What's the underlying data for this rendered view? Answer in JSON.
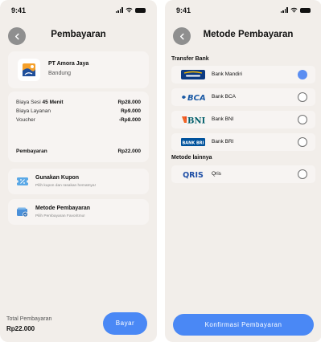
{
  "status": {
    "time": "9:41"
  },
  "payment": {
    "title": "Pembayaran",
    "merchant": {
      "name": "PT Amora Jaya",
      "city": "Bandung"
    },
    "details": [
      {
        "label_prefix": "Biaya Sesi ",
        "label_bold": "45 Menit",
        "value": "Rp28.000"
      },
      {
        "label_prefix": "Biaya Layanan",
        "label_bold": "",
        "value": "Rp9.000"
      },
      {
        "label_prefix": "Voucher",
        "label_bold": "",
        "value": "-Rp8.000"
      }
    ],
    "total": {
      "label": "Pembayaran",
      "value": "Rp22.000"
    },
    "coupon": {
      "title": "Gunakan Kupon",
      "subtitle": "Pilih kupon dan rasakan hematnya!"
    },
    "method": {
      "title": "Metode Pembayaran",
      "subtitle": "Pilih Pembayaran Favoritmu!"
    },
    "footer": {
      "label": "Total Pembayaran",
      "amount": "Rp22.000",
      "button": "Bayar"
    }
  },
  "methods": {
    "title": "Metode Pembayaran",
    "bank_section": "Transfer Bank",
    "banks": [
      {
        "name": "Bank Mandiri",
        "logo": "mandiri-logo",
        "selected": true
      },
      {
        "name": "Bank BCA",
        "logo": "bca-logo",
        "selected": false
      },
      {
        "name": "Bank BNI",
        "logo": "bni-logo",
        "selected": false
      },
      {
        "name": "Bank BRI",
        "logo": "bri-logo",
        "selected": false
      }
    ],
    "other_section": "Metode lainnya",
    "others": [
      {
        "name": "Qris",
        "logo": "qris-logo",
        "selected": false
      }
    ],
    "logo_text": {
      "bca": "BCA",
      "bni": "BNI",
      "qris": "QRIS",
      "bri": "BANK BRI"
    },
    "confirm_button": "Konfirmasi Pembayaran"
  },
  "colors": {
    "accent": "#4a88f5",
    "screen_bg": "#f2eeea",
    "card_bg": "#f7f4f2",
    "back_button": "#8f8f8f"
  }
}
